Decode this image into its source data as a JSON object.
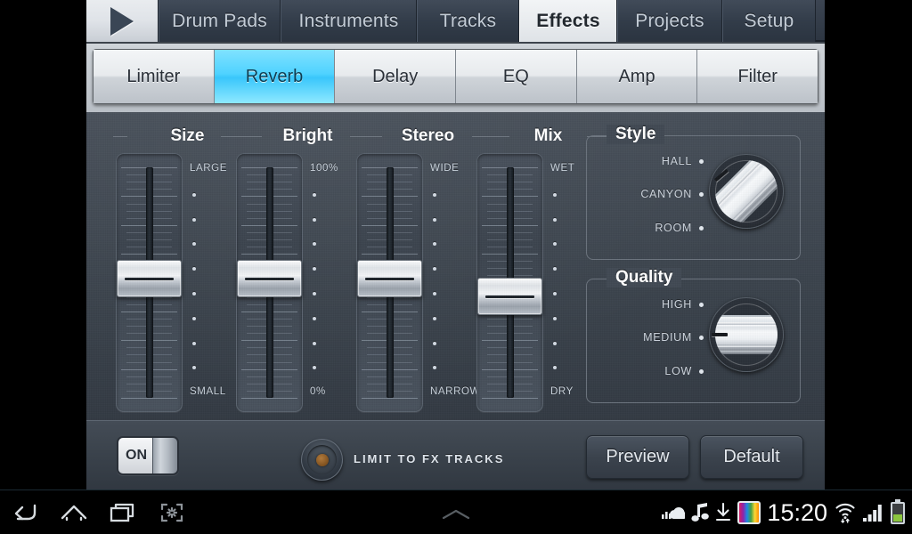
{
  "app": {
    "top_tabs": [
      {
        "label": "",
        "icon": "play-icon",
        "active": false
      },
      {
        "label": "Drum Pads",
        "active": false
      },
      {
        "label": "Instruments",
        "active": false
      },
      {
        "label": "Tracks",
        "active": false
      },
      {
        "label": "Effects",
        "active": true
      },
      {
        "label": "Projects",
        "active": false
      },
      {
        "label": "Setup",
        "active": false
      }
    ],
    "effect_tabs": [
      {
        "label": "Limiter",
        "active": false
      },
      {
        "label": "Reverb",
        "active": true
      },
      {
        "label": "Delay",
        "active": false
      },
      {
        "label": "EQ",
        "active": false
      },
      {
        "label": "Amp",
        "active": false
      },
      {
        "label": "Filter",
        "active": false
      }
    ],
    "accent_color": "#4fd2ff",
    "panel_color": "#3d444c"
  },
  "faders": [
    {
      "name": "Size",
      "top_label": "LARGE",
      "bottom_label": "SMALL",
      "value_pct": 52
    },
    {
      "name": "Bright",
      "top_label": "100%",
      "bottom_label": "0%",
      "value_pct": 52
    },
    {
      "name": "Stereo",
      "top_label": "WIDE",
      "bottom_label": "NARROW",
      "value_pct": 52
    },
    {
      "name": "Mix",
      "top_label": "WET",
      "bottom_label": "DRY",
      "value_pct": 43
    }
  ],
  "style_group": {
    "title": "Style",
    "options": [
      "HALL",
      "CANYON",
      "ROOM"
    ],
    "selected": "HALL"
  },
  "quality_group": {
    "title": "Quality",
    "options": [
      "HIGH",
      "MEDIUM",
      "LOW"
    ],
    "selected": "MEDIUM"
  },
  "bottom": {
    "toggle_label": "ON",
    "toggle_state": "on",
    "limit_label": "LIMIT TO FX TRACKS",
    "preview_label": "Preview",
    "default_label": "Default"
  },
  "system": {
    "nav": [
      "back-icon",
      "home-icon",
      "recents-icon",
      "screenshot-icon"
    ],
    "expand": "chevron-up-icon",
    "clock": "15:20",
    "tray_icons": [
      "sound-cloud-icon",
      "music-note-icon",
      "download-icon",
      "app-icon",
      "wifi-icon",
      "signal-icon",
      "battery-icon"
    ]
  }
}
